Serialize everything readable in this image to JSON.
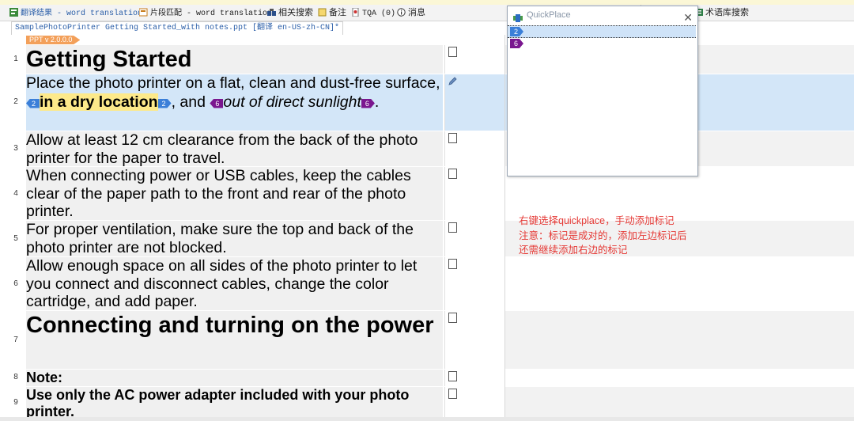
{
  "tabs": [
    {
      "label": "翻译结果 - word translation",
      "icon": "translation-result-icon",
      "active": true
    },
    {
      "label": "片段匹配 - word translation",
      "icon": "fragment-match-icon",
      "active": false
    },
    {
      "label": "相关搜索",
      "icon": "related-search-icon",
      "active": false
    },
    {
      "label": "备注",
      "icon": "notes-icon",
      "active": false
    },
    {
      "label": "TQA (0)",
      "icon": "tqa-icon",
      "active": false
    },
    {
      "label": "消息",
      "icon": "info-icon",
      "active": false
    },
    {
      "label": "术语库搜索",
      "icon": "termbase-search-icon",
      "active": false
    }
  ],
  "file_tab": "SamplePhotoPrinter Getting Started_with notes.ppt [翻译 en-US-zh-CN]*",
  "doc_tag": "PPT v 2.0.0.0",
  "segments": [
    {
      "num": "1",
      "text": "Getting Started"
    },
    {
      "num": "2",
      "p1": "Place the photo printer on a flat, clean and dust-free surface, ",
      "tag2": "2",
      "hl": "in a dry location",
      "tag2b": "2",
      "p2": ", and ",
      "tag6": "6",
      "it": "out of direct sunlight",
      "tag6b": "6",
      "p3": "."
    },
    {
      "num": "3",
      "text": "Allow at least 12 cm clearance from the back of the photo printer for the paper to travel."
    },
    {
      "num": "4",
      "text": "When connecting power or USB cables, keep the cables clear of the paper path to the front and rear of the photo printer."
    },
    {
      "num": "5",
      "text": "For proper ventilation, make sure the top and back of the photo printer are not blocked."
    },
    {
      "num": "6",
      "text": "Allow enough space on all sides of the photo printer to let you connect and disconnect cables, change the color cartridge, and add paper."
    },
    {
      "num": "7",
      "text": "Connecting and turning on the power"
    },
    {
      "num": "8",
      "text": "Note:"
    },
    {
      "num": "9",
      "text": "Use only the AC power adapter included with your photo printer."
    }
  ],
  "quickplace": {
    "title": "QuickPlace",
    "close": "✕",
    "items": [
      "2",
      "6"
    ]
  },
  "annotation": [
    "右键选择quickplace，手动添加标记",
    "注意：标记是成对的，添加左边标记后",
    "还需继续添加右边的标记"
  ],
  "colors": {
    "tag_blue": "#3b7fd8",
    "tag_purple": "#7a178f",
    "selected_row": "#d3e6f8",
    "highlight": "#fde98a",
    "annotation": "#e53935"
  }
}
